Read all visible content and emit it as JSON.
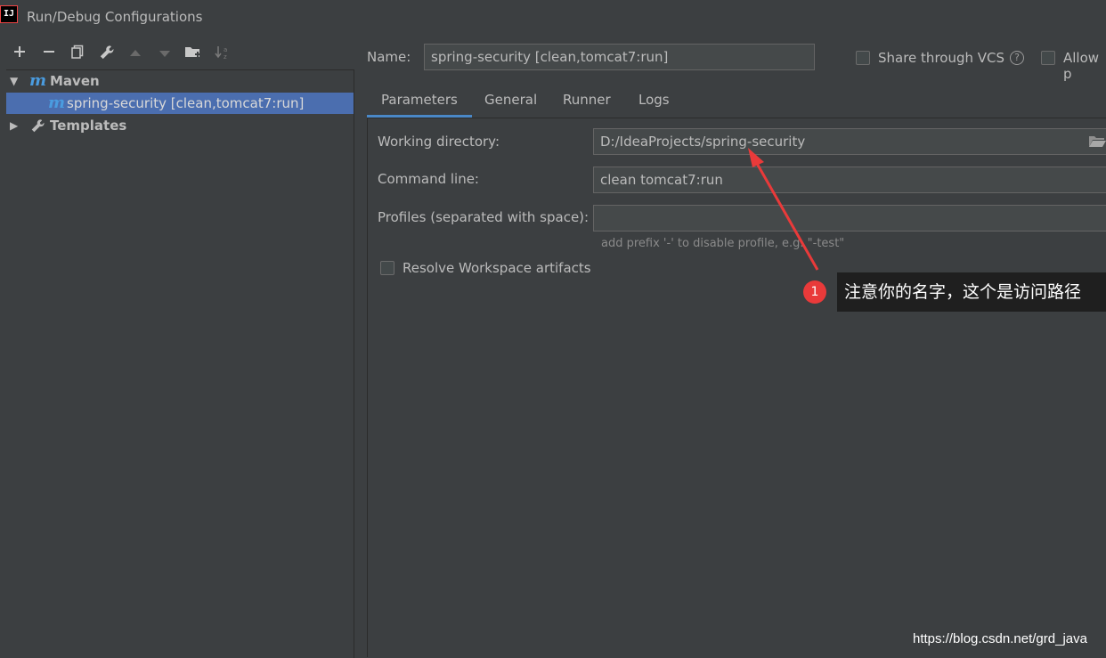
{
  "window": {
    "title": "Run/Debug Configurations",
    "app_icon_text": "IJ"
  },
  "toolbar": {
    "buttons": [
      {
        "icon": "plus-icon",
        "glyph": "+",
        "enabled": true
      },
      {
        "icon": "minus-icon",
        "glyph": "−",
        "enabled": true
      },
      {
        "icon": "copy-icon",
        "glyph": "⧉",
        "enabled": true
      },
      {
        "icon": "wrench-icon",
        "glyph": "🔧",
        "enabled": true
      },
      {
        "icon": "arrow-up-icon",
        "glyph": "▲",
        "enabled": false
      },
      {
        "icon": "arrow-down-icon",
        "glyph": "▼",
        "enabled": false
      },
      {
        "icon": "new-folder-icon",
        "glyph": "📁",
        "enabled": true
      },
      {
        "icon": "sort-icon",
        "glyph": "↓a",
        "enabled": false
      }
    ]
  },
  "tree": {
    "maven_label": "Maven",
    "maven_icon": "m",
    "config_label": "spring-security [clean,tomcat7:run]",
    "templates_label": "Templates"
  },
  "form": {
    "name_label": "Name:",
    "name_value": "spring-security [clean,tomcat7:run]",
    "share_vcs_label": "Share through VCS",
    "allow_label": "Allow p",
    "tabs": [
      "Parameters",
      "General",
      "Runner",
      "Logs"
    ],
    "active_tab": "Parameters",
    "working_dir_label": "Working directory:",
    "working_dir_value": "D:/IdeaProjects/spring-security",
    "command_line_label": "Command line:",
    "command_line_value": "clean tomcat7:run",
    "profiles_label": "Profiles (separated with space):",
    "profiles_value": "",
    "profiles_hint": "add prefix '-' to disable profile, e.g. \"-test\"",
    "resolve_label": "Resolve Workspace artifacts"
  },
  "annotation": {
    "number": "1",
    "text": "注意你的名字，这个是访问路径",
    "color": "#e93a3a"
  },
  "watermark": "https://blog.csdn.net/grd_java"
}
